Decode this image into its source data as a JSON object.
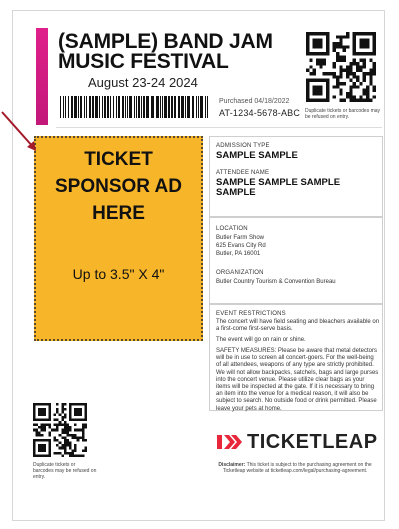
{
  "event": {
    "title": "(SAMPLE) BAND JAM MUSIC FESTIVAL",
    "date": "August 23-24 2024"
  },
  "purchase": {
    "purchased": "Purchased 04/18/2022",
    "ticket_id": "AT-1234-5678-ABC"
  },
  "qr_note_top": "Duplicate tickets or barcodes may be refused on entry.",
  "ad": {
    "title": "TICKET SPONSOR AD HERE",
    "size": "Up to 3.5\" X 4\""
  },
  "admission": {
    "type_label": "ADMISSION TYPE",
    "type_value": "SAMPLE SAMPLE",
    "attendee_label": "ATTENDEE NAME",
    "attendee_value": "SAMPLE SAMPLE SAMPLE SAMPLE"
  },
  "location": {
    "label": "LOCATION",
    "venue": "Butler Farm Show",
    "street": "625 Evans City Rd",
    "city": "Butler, PA 16001",
    "org_label": "ORGANIZATION",
    "org_value": "Butler Country Tourism & Convention Bureau"
  },
  "restrictions": {
    "label": "EVENT RESTRICTIONS",
    "seating": "The concert will have field seating and bleachers available on a first-come first-serve basis.",
    "weather": "The event will go on rain or shine.",
    "safety": "SAFETY MEASURES: Please be aware that metal detectors will be in use to screen all concert-goers. For the well-being of all attendees, weapons of any type are strictly prohibited. We will not allow backpacks, satchels, bags and large purses into the concert venue. Please utilize clear bags as your items will be inspected at the gate. If it is necessary to bring an item into the venue for a medical reason, it will also be subject to search. No outside food or drink permitted. Please leave your pets at home."
  },
  "qr_note_bottom": "Duplicate tickets or barcodes may be refused on entry.",
  "brand": {
    "logo_text": "TICKETLEAP",
    "disclaimer_label": "Disclaimer:",
    "disclaimer": "This ticket is subject to the purchasing agreement on the Ticketleap website at ticketleap.com/legal/purchasing-agreement."
  },
  "colors": {
    "accent_band": "#e0208a",
    "ad_fill": "#f7b52a",
    "arrow": "#a31a2a",
    "logo_red": "#e8273a"
  }
}
